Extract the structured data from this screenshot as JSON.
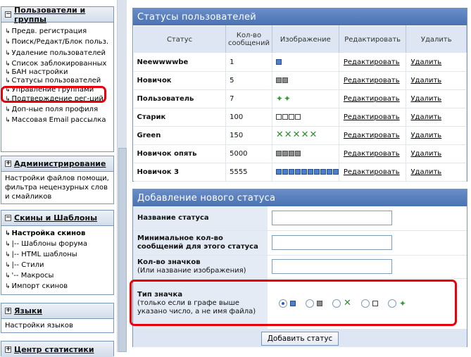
{
  "sidebar": {
    "users": {
      "title": "Пользователи и группы",
      "items": [
        "Предв. регистрация",
        "Поиск/Редакт/Блок польз.",
        "Удаление пользователей",
        "Список заблокированных",
        "БАН настройки",
        "Статусы пользователей",
        "Управление группами",
        "Подтверждение рег-ций",
        "Доп-ные поля профиля",
        "Массовая Email рассылка"
      ]
    },
    "admin": {
      "title": "Администрирование",
      "text": "Настройки файлов помощи, фильтра нецензурных слов и смайликов"
    },
    "skins": {
      "title": "Скины и Шаблоны",
      "items": [
        "Настройка скинов",
        "|-- Шаблоны форума",
        "|-- HTML шаблоны",
        "|-- Стили",
        "'-- Макросы",
        "Импорт скинов"
      ]
    },
    "langs": {
      "title": "Языки",
      "text": "Настройки языков"
    },
    "stats": {
      "title": "Центр статистики"
    }
  },
  "statuses": {
    "title": "Статусы пользователей",
    "headers": [
      "Статус",
      "Кол-во сообщений",
      "Изображение",
      "Редактировать",
      "Удалить"
    ],
    "edit_label": "Редактировать",
    "delete_label": "Удалить",
    "rows": [
      {
        "name": "Neewwwwbe",
        "posts": "1",
        "icon": "blue-pip",
        "count": 1
      },
      {
        "name": "Новичок",
        "posts": "5",
        "icon": "gray-pip",
        "count": 2
      },
      {
        "name": "Пользователь",
        "posts": "7",
        "icon": "green-star",
        "count": 2
      },
      {
        "name": "Старик",
        "posts": "100",
        "icon": "white-pip",
        "count": 4
      },
      {
        "name": "Green",
        "posts": "150",
        "icon": "green-x",
        "count": 5
      },
      {
        "name": "Новичок опять",
        "posts": "5000",
        "icon": "gray-pip",
        "count": 4
      },
      {
        "name": "Новичок 3",
        "posts": "5555",
        "icon": "blue-pip",
        "count": 10
      }
    ]
  },
  "add": {
    "title": "Добавление нового статуса",
    "name_label": "Название статуса",
    "min_label": "Минимальное кол-во сообщений для этого статуса",
    "count_label": "Кол-во значков",
    "count_note": "(Или название изображения)",
    "type_label": "Тип значка",
    "type_note": "(только если в графе выше указано число, а не имя файла)",
    "types": [
      "blue-pip",
      "gray-pip",
      "green-x",
      "white-pip",
      "green-star"
    ],
    "selected_type": "blue-pip",
    "submit": "Добавить статус"
  },
  "colors": {
    "header": "#4a72b3",
    "highlight": "#e8000b",
    "label_bg": "#e4ebf4"
  }
}
